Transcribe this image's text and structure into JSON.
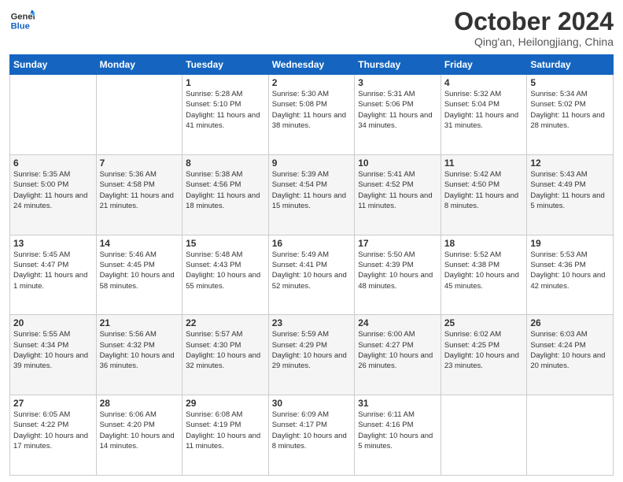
{
  "logo": {
    "line1": "General",
    "line2": "Blue"
  },
  "title": "October 2024",
  "location": "Qing'an, Heilongjiang, China",
  "days_of_week": [
    "Sunday",
    "Monday",
    "Tuesday",
    "Wednesday",
    "Thursday",
    "Friday",
    "Saturday"
  ],
  "weeks": [
    [
      {
        "day": null
      },
      {
        "day": null
      },
      {
        "day": "1",
        "sunrise": "Sunrise: 5:28 AM",
        "sunset": "Sunset: 5:10 PM",
        "daylight": "Daylight: 11 hours and 41 minutes."
      },
      {
        "day": "2",
        "sunrise": "Sunrise: 5:30 AM",
        "sunset": "Sunset: 5:08 PM",
        "daylight": "Daylight: 11 hours and 38 minutes."
      },
      {
        "day": "3",
        "sunrise": "Sunrise: 5:31 AM",
        "sunset": "Sunset: 5:06 PM",
        "daylight": "Daylight: 11 hours and 34 minutes."
      },
      {
        "day": "4",
        "sunrise": "Sunrise: 5:32 AM",
        "sunset": "Sunset: 5:04 PM",
        "daylight": "Daylight: 11 hours and 31 minutes."
      },
      {
        "day": "5",
        "sunrise": "Sunrise: 5:34 AM",
        "sunset": "Sunset: 5:02 PM",
        "daylight": "Daylight: 11 hours and 28 minutes."
      }
    ],
    [
      {
        "day": "6",
        "sunrise": "Sunrise: 5:35 AM",
        "sunset": "Sunset: 5:00 PM",
        "daylight": "Daylight: 11 hours and 24 minutes."
      },
      {
        "day": "7",
        "sunrise": "Sunrise: 5:36 AM",
        "sunset": "Sunset: 4:58 PM",
        "daylight": "Daylight: 11 hours and 21 minutes."
      },
      {
        "day": "8",
        "sunrise": "Sunrise: 5:38 AM",
        "sunset": "Sunset: 4:56 PM",
        "daylight": "Daylight: 11 hours and 18 minutes."
      },
      {
        "day": "9",
        "sunrise": "Sunrise: 5:39 AM",
        "sunset": "Sunset: 4:54 PM",
        "daylight": "Daylight: 11 hours and 15 minutes."
      },
      {
        "day": "10",
        "sunrise": "Sunrise: 5:41 AM",
        "sunset": "Sunset: 4:52 PM",
        "daylight": "Daylight: 11 hours and 11 minutes."
      },
      {
        "day": "11",
        "sunrise": "Sunrise: 5:42 AM",
        "sunset": "Sunset: 4:50 PM",
        "daylight": "Daylight: 11 hours and 8 minutes."
      },
      {
        "day": "12",
        "sunrise": "Sunrise: 5:43 AM",
        "sunset": "Sunset: 4:49 PM",
        "daylight": "Daylight: 11 hours and 5 minutes."
      }
    ],
    [
      {
        "day": "13",
        "sunrise": "Sunrise: 5:45 AM",
        "sunset": "Sunset: 4:47 PM",
        "daylight": "Daylight: 11 hours and 1 minute."
      },
      {
        "day": "14",
        "sunrise": "Sunrise: 5:46 AM",
        "sunset": "Sunset: 4:45 PM",
        "daylight": "Daylight: 10 hours and 58 minutes."
      },
      {
        "day": "15",
        "sunrise": "Sunrise: 5:48 AM",
        "sunset": "Sunset: 4:43 PM",
        "daylight": "Daylight: 10 hours and 55 minutes."
      },
      {
        "day": "16",
        "sunrise": "Sunrise: 5:49 AM",
        "sunset": "Sunset: 4:41 PM",
        "daylight": "Daylight: 10 hours and 52 minutes."
      },
      {
        "day": "17",
        "sunrise": "Sunrise: 5:50 AM",
        "sunset": "Sunset: 4:39 PM",
        "daylight": "Daylight: 10 hours and 48 minutes."
      },
      {
        "day": "18",
        "sunrise": "Sunrise: 5:52 AM",
        "sunset": "Sunset: 4:38 PM",
        "daylight": "Daylight: 10 hours and 45 minutes."
      },
      {
        "day": "19",
        "sunrise": "Sunrise: 5:53 AM",
        "sunset": "Sunset: 4:36 PM",
        "daylight": "Daylight: 10 hours and 42 minutes."
      }
    ],
    [
      {
        "day": "20",
        "sunrise": "Sunrise: 5:55 AM",
        "sunset": "Sunset: 4:34 PM",
        "daylight": "Daylight: 10 hours and 39 minutes."
      },
      {
        "day": "21",
        "sunrise": "Sunrise: 5:56 AM",
        "sunset": "Sunset: 4:32 PM",
        "daylight": "Daylight: 10 hours and 36 minutes."
      },
      {
        "day": "22",
        "sunrise": "Sunrise: 5:57 AM",
        "sunset": "Sunset: 4:30 PM",
        "daylight": "Daylight: 10 hours and 32 minutes."
      },
      {
        "day": "23",
        "sunrise": "Sunrise: 5:59 AM",
        "sunset": "Sunset: 4:29 PM",
        "daylight": "Daylight: 10 hours and 29 minutes."
      },
      {
        "day": "24",
        "sunrise": "Sunrise: 6:00 AM",
        "sunset": "Sunset: 4:27 PM",
        "daylight": "Daylight: 10 hours and 26 minutes."
      },
      {
        "day": "25",
        "sunrise": "Sunrise: 6:02 AM",
        "sunset": "Sunset: 4:25 PM",
        "daylight": "Daylight: 10 hours and 23 minutes."
      },
      {
        "day": "26",
        "sunrise": "Sunrise: 6:03 AM",
        "sunset": "Sunset: 4:24 PM",
        "daylight": "Daylight: 10 hours and 20 minutes."
      }
    ],
    [
      {
        "day": "27",
        "sunrise": "Sunrise: 6:05 AM",
        "sunset": "Sunset: 4:22 PM",
        "daylight": "Daylight: 10 hours and 17 minutes."
      },
      {
        "day": "28",
        "sunrise": "Sunrise: 6:06 AM",
        "sunset": "Sunset: 4:20 PM",
        "daylight": "Daylight: 10 hours and 14 minutes."
      },
      {
        "day": "29",
        "sunrise": "Sunrise: 6:08 AM",
        "sunset": "Sunset: 4:19 PM",
        "daylight": "Daylight: 10 hours and 11 minutes."
      },
      {
        "day": "30",
        "sunrise": "Sunrise: 6:09 AM",
        "sunset": "Sunset: 4:17 PM",
        "daylight": "Daylight: 10 hours and 8 minutes."
      },
      {
        "day": "31",
        "sunrise": "Sunrise: 6:11 AM",
        "sunset": "Sunset: 4:16 PM",
        "daylight": "Daylight: 10 hours and 5 minutes."
      },
      {
        "day": null
      },
      {
        "day": null
      }
    ]
  ]
}
